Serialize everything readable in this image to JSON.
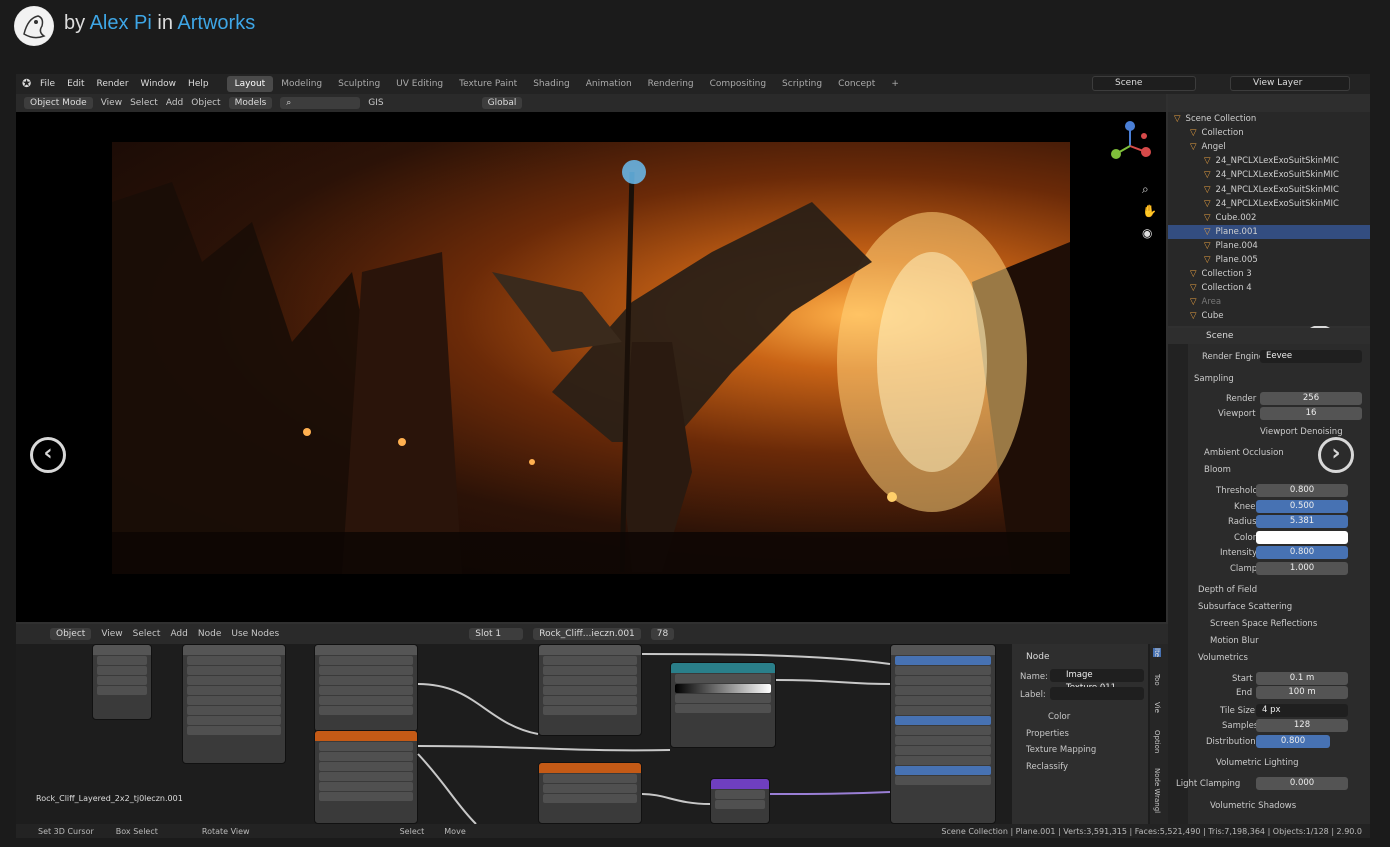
{
  "post": {
    "by": "by",
    "author": "Alex Pi",
    "in": "in",
    "category": "Artworks"
  },
  "topbar": {
    "menu": [
      "File",
      "Edit",
      "Render",
      "Window",
      "Help"
    ],
    "workspaces": [
      "Layout",
      "Modeling",
      "Sculpting",
      "UV Editing",
      "Texture Paint",
      "Shading",
      "Animation",
      "Rendering",
      "Compositing",
      "Scripting",
      "Concept",
      "+"
    ],
    "scene": "Scene",
    "view_layer": "View Layer"
  },
  "viewport_header": {
    "mode": "Object Mode",
    "view": "View",
    "select": "Select",
    "add": "Add",
    "object": "Object",
    "models": "Models",
    "gis": "GIS",
    "transform": "Global"
  },
  "outliner": {
    "rows": [
      "Scene Collection",
      "Collection",
      "Angel",
      "24_NPCLXLexExoSuitSkinMIC",
      "24_NPCLXLexExoSuitSkinMIC",
      "24_NPCLXLexExoSuitSkinMIC",
      "24_NPCLXLexExoSuitSkinMIC",
      "Cube.002",
      "Plane.001",
      "Plane.004",
      "Plane.005",
      "Collection 3",
      "Collection 4",
      "Area",
      "Cube"
    ],
    "selected_index": 8
  },
  "properties": {
    "scene": "Scene",
    "render_engine_label": "Render Engine",
    "render_engine": "Eevee",
    "sampling": "Sampling",
    "render_label": "Render",
    "render_value": "256",
    "viewport_label": "Viewport",
    "viewport_value": "16",
    "viewport_denoising": "Viewport Denoising",
    "ambient_occlusion": "Ambient Occlusion",
    "bloom": "Bloom",
    "threshold_label": "Threshold",
    "threshold": "0.800",
    "knee_label": "Knee",
    "knee": "0.500",
    "radius_label": "Radius",
    "radius": "5.381",
    "color_label": "Color",
    "intensity_label": "Intensity",
    "intensity": "0.800",
    "clamp_label": "Clamp",
    "clamp": "1.000",
    "depth_of_field": "Depth of Field",
    "subsurface_scattering": "Subsurface Scattering",
    "ssr": "Screen Space Reflections",
    "motion_blur": "Motion Blur",
    "volumetrics": "Volumetrics",
    "start_label": "Start",
    "start": "0.1 m",
    "end_label": "End",
    "end": "100 m",
    "tile_size_label": "Tile Size",
    "tile_size": "4 px",
    "samples_label": "Samples",
    "samples": "128",
    "distribution_label": "Distribution",
    "distribution": "0.800",
    "volumetric_lighting": "Volumetric Lighting",
    "light_clamping_label": "Light Clamping",
    "light_clamping": "0.000",
    "volumetric_shadows": "Volumetric Shadows"
  },
  "node_editor": {
    "object": "Object",
    "view": "View",
    "select": "Select",
    "add": "Add",
    "node": "Node",
    "use_nodes": "Use Nodes",
    "slot": "Slot 1",
    "material": "Rock_Cliff...ieczn.001",
    "users": "78",
    "label": "Rock_Cliff_Layered_2x2_tj0leczn.001",
    "panel": {
      "title": "Node",
      "name_label": "Name:",
      "name_value": "Image Texture.011",
      "label_label": "Label:",
      "color": "Color",
      "properties": "Properties",
      "texture_mapping": "Texture Mapping",
      "reclassify": "Reclassify"
    },
    "side_tabs": [
      "Ite",
      "Too",
      "Vie",
      "Option",
      "Node Wrangl"
    ]
  },
  "status": {
    "set_cursor": "Set 3D Cursor",
    "box_select": "Box Select",
    "rotate_view": "Rotate View",
    "select": "Select",
    "move": "Move",
    "info": "Scene Collection | Plane.001 | Verts:3,591,315 | Faces:5,521,490 | Tris:7,198,364 | Objects:1/128 | 2.90.0"
  }
}
